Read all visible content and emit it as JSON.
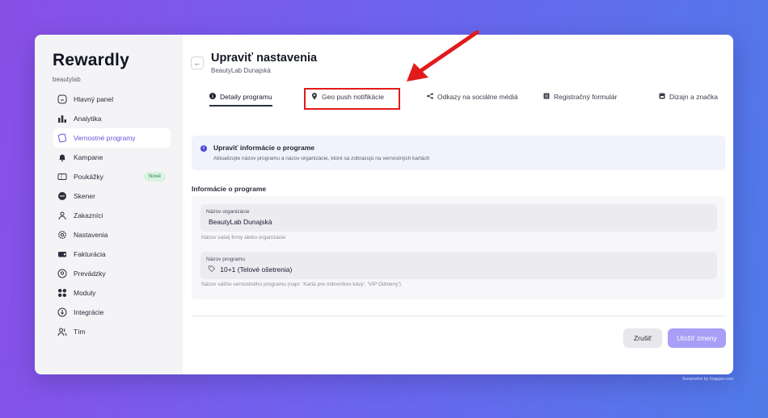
{
  "app": {
    "logo": "Rewardly",
    "organization": "beautylab"
  },
  "sidebar": {
    "items": [
      {
        "label": "Hlavný panel",
        "icon": "home-icon",
        "glyph": "⌂"
      },
      {
        "label": "Analytika",
        "icon": "bar-chart-icon",
        "glyph": "▮"
      },
      {
        "label": "Vernostné programy",
        "icon": "cards-icon",
        "glyph": "▯"
      },
      {
        "label": "Kampane",
        "icon": "bell-icon",
        "glyph": "🔔"
      },
      {
        "label": "Poukážky",
        "icon": "voucher-icon",
        "glyph": "▭",
        "badge": "Nové"
      },
      {
        "label": "Skener",
        "icon": "scanner-icon",
        "glyph": "◉"
      },
      {
        "label": "Zakazníci",
        "icon": "customers-icon",
        "glyph": "⚇"
      },
      {
        "label": "Nastavenia",
        "icon": "gear-icon",
        "glyph": "⚙"
      },
      {
        "label": "Fakturácia",
        "icon": "billing-icon",
        "glyph": "▬"
      },
      {
        "label": "Prevádzky",
        "icon": "location-icon",
        "glyph": "◎"
      },
      {
        "label": "Moduly",
        "icon": "modules-icon",
        "glyph": "▦"
      },
      {
        "label": "Integrácie",
        "icon": "integrations-icon",
        "glyph": "⊚"
      },
      {
        "label": "Tím",
        "icon": "team-icon",
        "glyph": "⚇"
      }
    ],
    "active_index": 2
  },
  "header": {
    "back_glyph": "←",
    "title": "Upraviť nastavenia",
    "subtitle": "BeautyLab Dunajská"
  },
  "tabs": [
    {
      "label": "Detaily programu",
      "icon": "info-icon",
      "glyph": "●"
    },
    {
      "label": "Geo push notifikácie",
      "icon": "map-pin-icon",
      "glyph": "⬤"
    },
    {
      "label": "Odkazy na sociálne médiá",
      "icon": "share-icon",
      "glyph": "<"
    },
    {
      "label": "Registračný formulár",
      "icon": "form-icon",
      "glyph": "▣"
    },
    {
      "label": "Dizajn a značka",
      "icon": "design-icon",
      "glyph": "▣"
    }
  ],
  "info": {
    "title": "Upraviť informácie o programe",
    "description": "Aktualizujte názov programu a názov organizácie, ktoré sa zobrazujú na vernostných kartách"
  },
  "section": {
    "title": "Informácie o programe"
  },
  "fields": {
    "org_name_label": "Názov organizácie",
    "org_name_value": "BeautyLab Dunajská",
    "org_name_help": "Názov vašej firmy alebo organizácie",
    "program_name_label": "Názov programu",
    "program_name_value": "10+1 (Telové ošetrenia)",
    "program_name_help": "Názov vášho vernostného programu (napr. 'Karta pre milovníkov kávy', 'VIP Odmeny')"
  },
  "actions": {
    "cancel": "Zrušiť",
    "save": "Uložiť zmeny"
  },
  "watermark": "Screenshot by Xnapper.com",
  "colors": {
    "accent": "#6d52d8",
    "save_button": "#a89ef6",
    "annotation": "#e21a1a"
  }
}
